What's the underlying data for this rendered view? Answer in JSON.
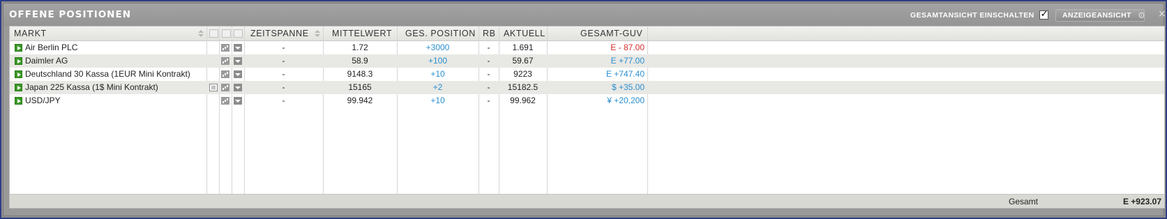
{
  "window": {
    "title": "OFFENE POSITIONEN",
    "gesamt_toggle_label": "GESAMTANSICHT EINSCHALTEN",
    "gesamt_toggle_checked": true,
    "view_button_label": "ANZEIGEANSICHT",
    "close_symbol": "×"
  },
  "columns": {
    "markt": "MARKT",
    "zeitspanne": "ZEITSPANNE",
    "mittelwert": "MITTELWERT",
    "ges_position": "GES. POSITION",
    "rb": "RB",
    "aktuell": "AKTUELL",
    "gesamt_guv": "GESAMT-GUV"
  },
  "rows": [
    {
      "markt": "Air Berlin PLC",
      "zeitspanne": "-",
      "mittelwert": "1.72",
      "position": "+3000",
      "rb": "-",
      "aktuell": "1.691",
      "guv": "E - 87.00",
      "guv_color": "#d42a2a",
      "has_doc": false
    },
    {
      "markt": "Daimler AG",
      "zeitspanne": "-",
      "mittelwert": "58.9",
      "position": "+100",
      "rb": "-",
      "aktuell": "59.67",
      "guv": "E +77.00",
      "guv_color": "#2a8fd0",
      "has_doc": false
    },
    {
      "markt": "Deutschland 30 Kassa (1EUR Mini Kontrakt)",
      "zeitspanne": "-",
      "mittelwert": "9148.3",
      "position": "+10",
      "rb": "-",
      "aktuell": "9223",
      "guv": "E +747.40",
      "guv_color": "#2a8fd0",
      "has_doc": false
    },
    {
      "markt": "Japan 225 Kassa (1$ Mini Kontrakt)",
      "zeitspanne": "-",
      "mittelwert": "15165",
      "position": "+2",
      "rb": "-",
      "aktuell": "15182.5",
      "guv": "$ +35.00",
      "guv_color": "#2a8fd0",
      "has_doc": true
    },
    {
      "markt": "USD/JPY",
      "zeitspanne": "-",
      "mittelwert": "99.942",
      "position": "+10",
      "rb": "-",
      "aktuell": "99.962",
      "guv": "¥ +20,200",
      "guv_color": "#2a8fd0",
      "has_doc": false
    }
  ],
  "footer": {
    "label": "Gesamt",
    "value": "E +923.07"
  },
  "colors": {
    "positive": "#2a8fd0",
    "negative": "#d42a2a",
    "market_play": "#3b9a27",
    "frame": "#2e3d86"
  }
}
